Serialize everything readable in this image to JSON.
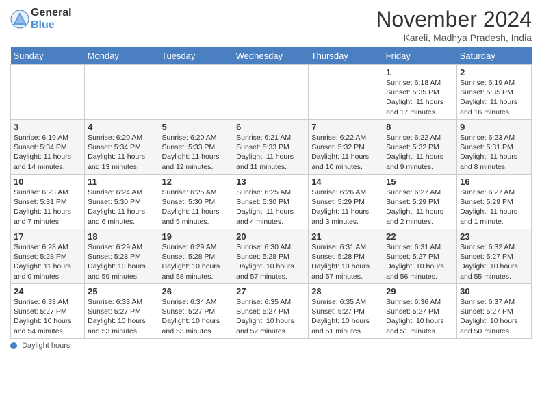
{
  "logo": {
    "general": "General",
    "blue": "Blue"
  },
  "title": "November 2024",
  "subtitle": "Kareli, Madhya Pradesh, India",
  "days_of_week": [
    "Sunday",
    "Monday",
    "Tuesday",
    "Wednesday",
    "Thursday",
    "Friday",
    "Saturday"
  ],
  "footer_label": "Daylight hours",
  "weeks": [
    [
      {
        "day": "",
        "info": ""
      },
      {
        "day": "",
        "info": ""
      },
      {
        "day": "",
        "info": ""
      },
      {
        "day": "",
        "info": ""
      },
      {
        "day": "",
        "info": ""
      },
      {
        "day": "1",
        "info": "Sunrise: 6:18 AM\nSunset: 5:35 PM\nDaylight: 11 hours and 17 minutes."
      },
      {
        "day": "2",
        "info": "Sunrise: 6:19 AM\nSunset: 5:35 PM\nDaylight: 11 hours and 16 minutes."
      }
    ],
    [
      {
        "day": "3",
        "info": "Sunrise: 6:19 AM\nSunset: 5:34 PM\nDaylight: 11 hours and 14 minutes."
      },
      {
        "day": "4",
        "info": "Sunrise: 6:20 AM\nSunset: 5:34 PM\nDaylight: 11 hours and 13 minutes."
      },
      {
        "day": "5",
        "info": "Sunrise: 6:20 AM\nSunset: 5:33 PM\nDaylight: 11 hours and 12 minutes."
      },
      {
        "day": "6",
        "info": "Sunrise: 6:21 AM\nSunset: 5:33 PM\nDaylight: 11 hours and 11 minutes."
      },
      {
        "day": "7",
        "info": "Sunrise: 6:22 AM\nSunset: 5:32 PM\nDaylight: 11 hours and 10 minutes."
      },
      {
        "day": "8",
        "info": "Sunrise: 6:22 AM\nSunset: 5:32 PM\nDaylight: 11 hours and 9 minutes."
      },
      {
        "day": "9",
        "info": "Sunrise: 6:23 AM\nSunset: 5:31 PM\nDaylight: 11 hours and 8 minutes."
      }
    ],
    [
      {
        "day": "10",
        "info": "Sunrise: 6:23 AM\nSunset: 5:31 PM\nDaylight: 11 hours and 7 minutes."
      },
      {
        "day": "11",
        "info": "Sunrise: 6:24 AM\nSunset: 5:30 PM\nDaylight: 11 hours and 6 minutes."
      },
      {
        "day": "12",
        "info": "Sunrise: 6:25 AM\nSunset: 5:30 PM\nDaylight: 11 hours and 5 minutes."
      },
      {
        "day": "13",
        "info": "Sunrise: 6:25 AM\nSunset: 5:30 PM\nDaylight: 11 hours and 4 minutes."
      },
      {
        "day": "14",
        "info": "Sunrise: 6:26 AM\nSunset: 5:29 PM\nDaylight: 11 hours and 3 minutes."
      },
      {
        "day": "15",
        "info": "Sunrise: 6:27 AM\nSunset: 5:29 PM\nDaylight: 11 hours and 2 minutes."
      },
      {
        "day": "16",
        "info": "Sunrise: 6:27 AM\nSunset: 5:29 PM\nDaylight: 11 hours and 1 minute."
      }
    ],
    [
      {
        "day": "17",
        "info": "Sunrise: 6:28 AM\nSunset: 5:28 PM\nDaylight: 11 hours and 0 minutes."
      },
      {
        "day": "18",
        "info": "Sunrise: 6:29 AM\nSunset: 5:28 PM\nDaylight: 10 hours and 59 minutes."
      },
      {
        "day": "19",
        "info": "Sunrise: 6:29 AM\nSunset: 5:28 PM\nDaylight: 10 hours and 58 minutes."
      },
      {
        "day": "20",
        "info": "Sunrise: 6:30 AM\nSunset: 5:28 PM\nDaylight: 10 hours and 57 minutes."
      },
      {
        "day": "21",
        "info": "Sunrise: 6:31 AM\nSunset: 5:28 PM\nDaylight: 10 hours and 57 minutes."
      },
      {
        "day": "22",
        "info": "Sunrise: 6:31 AM\nSunset: 5:27 PM\nDaylight: 10 hours and 56 minutes."
      },
      {
        "day": "23",
        "info": "Sunrise: 6:32 AM\nSunset: 5:27 PM\nDaylight: 10 hours and 55 minutes."
      }
    ],
    [
      {
        "day": "24",
        "info": "Sunrise: 6:33 AM\nSunset: 5:27 PM\nDaylight: 10 hours and 54 minutes."
      },
      {
        "day": "25",
        "info": "Sunrise: 6:33 AM\nSunset: 5:27 PM\nDaylight: 10 hours and 53 minutes."
      },
      {
        "day": "26",
        "info": "Sunrise: 6:34 AM\nSunset: 5:27 PM\nDaylight: 10 hours and 53 minutes."
      },
      {
        "day": "27",
        "info": "Sunrise: 6:35 AM\nSunset: 5:27 PM\nDaylight: 10 hours and 52 minutes."
      },
      {
        "day": "28",
        "info": "Sunrise: 6:35 AM\nSunset: 5:27 PM\nDaylight: 10 hours and 51 minutes."
      },
      {
        "day": "29",
        "info": "Sunrise: 6:36 AM\nSunset: 5:27 PM\nDaylight: 10 hours and 51 minutes."
      },
      {
        "day": "30",
        "info": "Sunrise: 6:37 AM\nSunset: 5:27 PM\nDaylight: 10 hours and 50 minutes."
      }
    ]
  ]
}
